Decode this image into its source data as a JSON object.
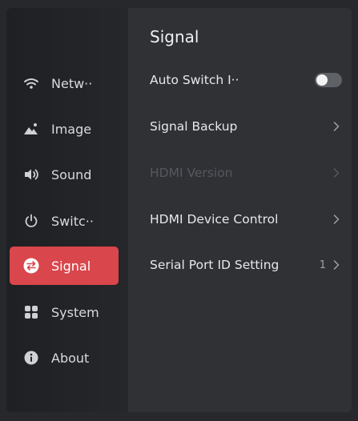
{
  "sidebar": {
    "items": [
      {
        "label": "Netw··",
        "icon": "wifi-icon",
        "active": false
      },
      {
        "label": "Image",
        "icon": "image-icon",
        "active": false
      },
      {
        "label": "Sound",
        "icon": "speaker-icon",
        "active": false
      },
      {
        "label": "Switc··",
        "icon": "power-icon",
        "active": false
      },
      {
        "label": "Signal",
        "icon": "signal-switch-icon",
        "active": true
      },
      {
        "label": "System",
        "icon": "grid-icon",
        "active": false
      },
      {
        "label": "About",
        "icon": "info-icon",
        "active": false
      }
    ]
  },
  "main": {
    "title": "Signal",
    "rows": [
      {
        "label": "Auto Switch I··",
        "control": "toggle",
        "toggle_on": false,
        "disabled": false
      },
      {
        "label": "Signal Backup",
        "control": "chevron",
        "disabled": false
      },
      {
        "label": "HDMI Version",
        "control": "chevron",
        "disabled": true
      },
      {
        "label": "HDMI Device Control",
        "control": "chevron",
        "disabled": false
      },
      {
        "label": "Serial Port ID Setting",
        "control": "chevron",
        "value": "1",
        "disabled": false
      }
    ]
  },
  "colors": {
    "accent": "#d9464b",
    "background": "#2f3135",
    "sidebar": "#1e2023",
    "text": "#e7e8ea",
    "disabled_text": "#55585d"
  }
}
